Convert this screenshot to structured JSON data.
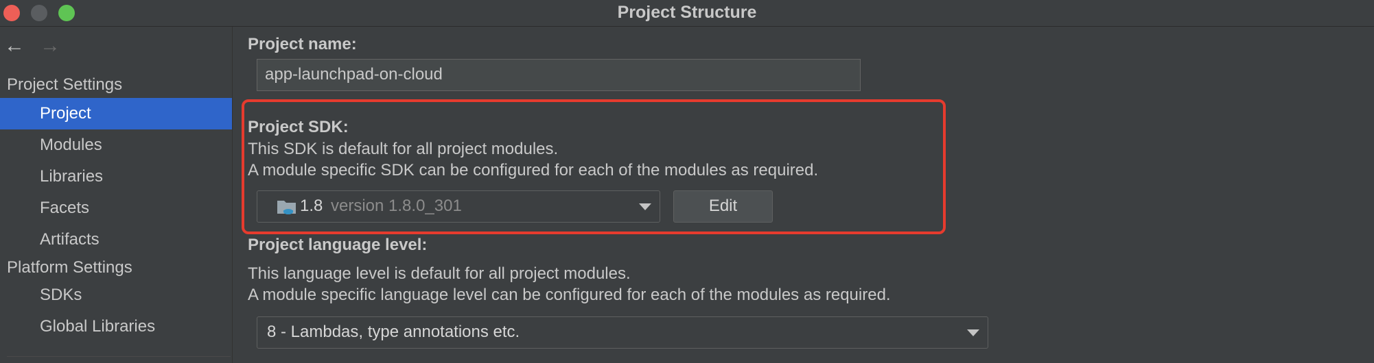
{
  "window": {
    "title": "Project Structure"
  },
  "sidebar": {
    "sections": [
      {
        "header": "Project Settings",
        "items": [
          "Project",
          "Modules",
          "Libraries",
          "Facets",
          "Artifacts"
        ]
      },
      {
        "header": "Platform Settings",
        "items": [
          "SDKs",
          "Global Libraries"
        ]
      }
    ],
    "selected": "Project"
  },
  "project_name": {
    "label": "Project name:",
    "value": "app-launchpad-on-cloud"
  },
  "project_sdk": {
    "label": "Project SDK:",
    "desc_line1": "This SDK is default for all project modules.",
    "desc_line2": "A module specific SDK can be configured for each of the modules as required.",
    "selected_name": "1.8",
    "selected_version": "version 1.8.0_301",
    "edit_label": "Edit"
  },
  "language_level": {
    "label": "Project language level:",
    "desc_line1": "This language level is default for all project modules.",
    "desc_line2": "A module specific language level can be configured for each of the modules as required.",
    "selected": "8 - Lambdas, type annotations etc."
  },
  "colors": {
    "selection": "#2f65ca",
    "highlight_box": "#e63b2e",
    "close": "#ee5f57",
    "maximize": "#5fc454"
  }
}
